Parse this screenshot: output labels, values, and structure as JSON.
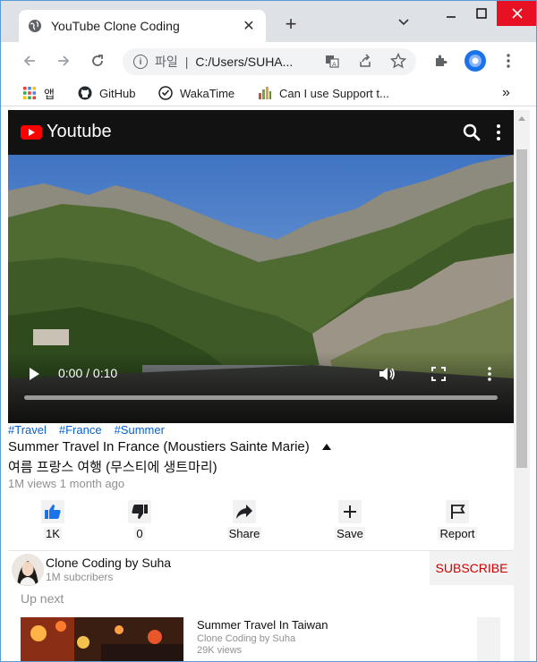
{
  "browser": {
    "tab_title": "YouTube Clone Coding",
    "tab_close": "✕",
    "new_tab": "+",
    "address_chip": "파일",
    "address_sep": "|",
    "address_url": "C:/Users/SUHA...",
    "bookmarks": [
      {
        "label": "앱",
        "icon": "apps-grid-icon"
      },
      {
        "label": "GitHub",
        "icon": "github-icon"
      },
      {
        "label": "WakaTime",
        "icon": "wakatime-icon"
      },
      {
        "label": "Can I use Support t...",
        "icon": "caniuse-icon"
      }
    ],
    "bookmarks_more": "»"
  },
  "header": {
    "brand": "Youtube"
  },
  "video": {
    "time": "0:00 / 0:10",
    "progress": 0.0
  },
  "info": {
    "tags": [
      "#Travel",
      "#France",
      "#Summer"
    ],
    "title": "Summer Travel In France (Moustiers Sainte Marie)",
    "subtitle": "여름 프랑스 여행 (무스티에 생트마리)",
    "meta": "1M views 1 month ago"
  },
  "actions": {
    "like": "1K",
    "dislike": "0",
    "share": "Share",
    "save": "Save",
    "report": "Report"
  },
  "channel": {
    "name": "Clone Coding by Suha",
    "subs": "1M subcribers",
    "subscribe": "SUBSCRIBE"
  },
  "upnext": {
    "heading": "Up next",
    "items": [
      {
        "title": "Summer Travel In Taiwan",
        "channel": "Clone Coding by Suha",
        "views": "29K views"
      }
    ]
  },
  "colors": {
    "brand_red": "#ff0000",
    "header_bg": "#121212",
    "tag_blue": "#065fd4",
    "subscribe_red": "#cc0000",
    "close_red": "#e81123"
  }
}
